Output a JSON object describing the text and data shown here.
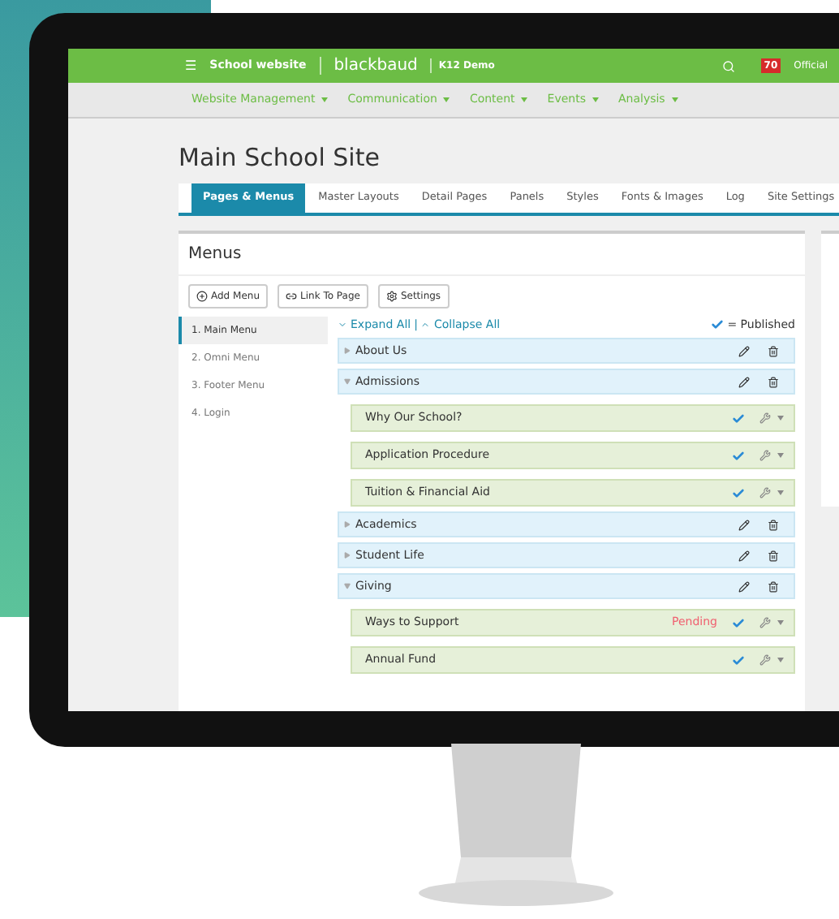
{
  "header": {
    "menu_icon": "☰",
    "site": "School website",
    "brand": "blackbaud",
    "product": "K12 Demo",
    "notifications": "70",
    "user": "Official"
  },
  "nav": [
    {
      "label": "Website Management"
    },
    {
      "label": "Communication"
    },
    {
      "label": "Content"
    },
    {
      "label": "Events"
    },
    {
      "label": "Analysis"
    }
  ],
  "page_title": "Main School Site",
  "tabs": [
    {
      "label": "Pages & Menus",
      "selected": true
    },
    {
      "label": "Master Layouts",
      "selected": false
    },
    {
      "label": "Detail Pages",
      "selected": false
    },
    {
      "label": "Panels",
      "selected": false
    },
    {
      "label": "Styles",
      "selected": false
    },
    {
      "label": "Fonts & Images",
      "selected": false
    },
    {
      "label": "Log",
      "selected": false
    },
    {
      "label": "Site Settings",
      "selected": false
    }
  ],
  "menus": {
    "title": "Menus",
    "buttons": [
      {
        "label": "Add Menu",
        "kind": "add"
      },
      {
        "label": "Link To Page",
        "kind": "link"
      },
      {
        "label": "Settings",
        "kind": "settings"
      }
    ],
    "list": [
      {
        "label": "1. Main Menu",
        "selected": true
      },
      {
        "label": "2. Omni Menu",
        "selected": false
      },
      {
        "label": "3. Footer Menu",
        "selected": false
      },
      {
        "label": "4. Login",
        "selected": false
      }
    ],
    "expand_all": "Expand All",
    "separator": "|",
    "collapse_all": "Collapse All",
    "legend": "= Published",
    "items": [
      {
        "label": "About Us",
        "expanded": false
      },
      {
        "label": "Admissions",
        "expanded": true,
        "children": [
          {
            "label": "Why Our School?",
            "published": true
          },
          {
            "label": "Application Procedure",
            "published": true
          },
          {
            "label": "Tuition & Financial Aid",
            "published": true
          }
        ]
      },
      {
        "label": "Academics",
        "expanded": false
      },
      {
        "label": "Student Life",
        "expanded": false
      },
      {
        "label": "Giving",
        "expanded": true,
        "children": [
          {
            "label": "Ways to Support",
            "published": true,
            "status": "Pending"
          },
          {
            "label": "Annual Fund",
            "published": true
          }
        ]
      }
    ]
  }
}
